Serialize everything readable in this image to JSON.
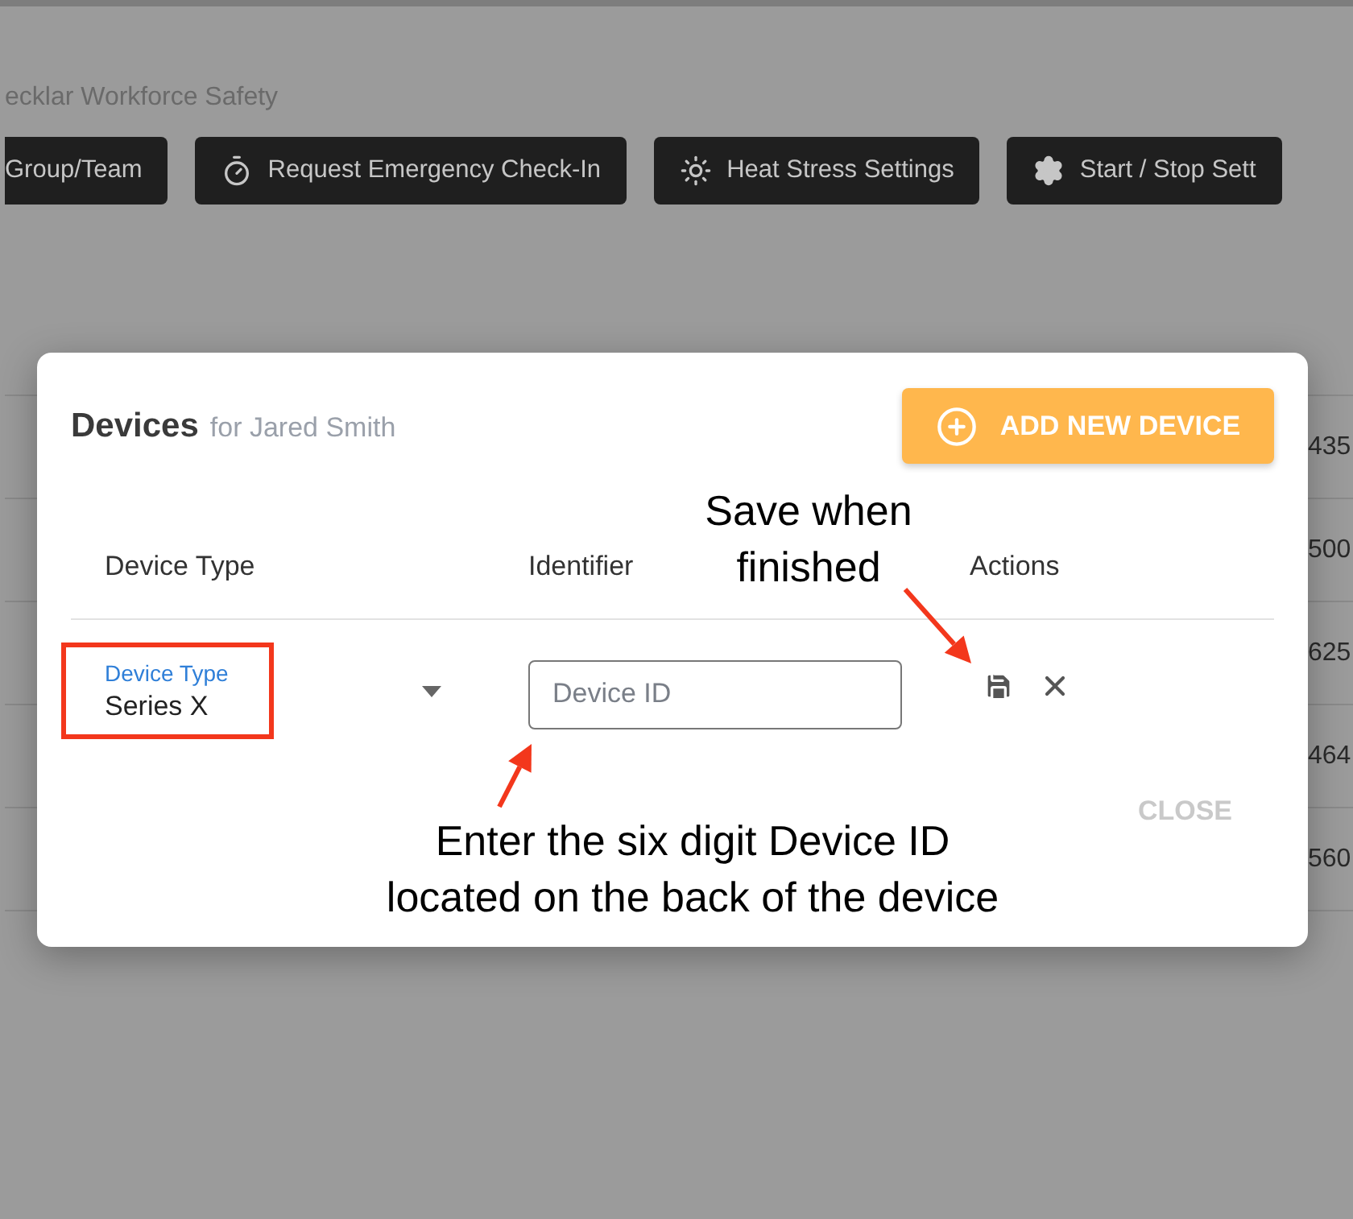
{
  "app_title": "ecklar Workforce Safety",
  "toolbar": [
    {
      "label": "Group/Team",
      "kind": "plain"
    },
    {
      "label": "Request Emergency Check-In",
      "kind": "timer"
    },
    {
      "label": "Heat Stress Settings",
      "kind": "heat"
    },
    {
      "label": "Start / Stop Sett",
      "kind": "settings"
    }
  ],
  "table": {
    "phone_cells": [
      "435",
      "500",
      "625",
      "464",
      "560"
    ]
  },
  "dialog": {
    "title": "Devices",
    "subtitle": "for Jared Smith",
    "add_button": "ADD NEW DEVICE",
    "columns": [
      "Device Type",
      "Identifier",
      "Actions"
    ],
    "row": {
      "type_label": "Device Type",
      "type_value": "Series X",
      "identifier_placeholder": "Device ID"
    },
    "close_button": "CLOSE"
  },
  "annotations": [
    {
      "kind": "save",
      "lines": [
        "Save when",
        "finished"
      ]
    },
    {
      "kind": "identifier",
      "lines": [
        "Enter the six digit Device ID",
        "located on the back of the device"
      ]
    }
  ]
}
